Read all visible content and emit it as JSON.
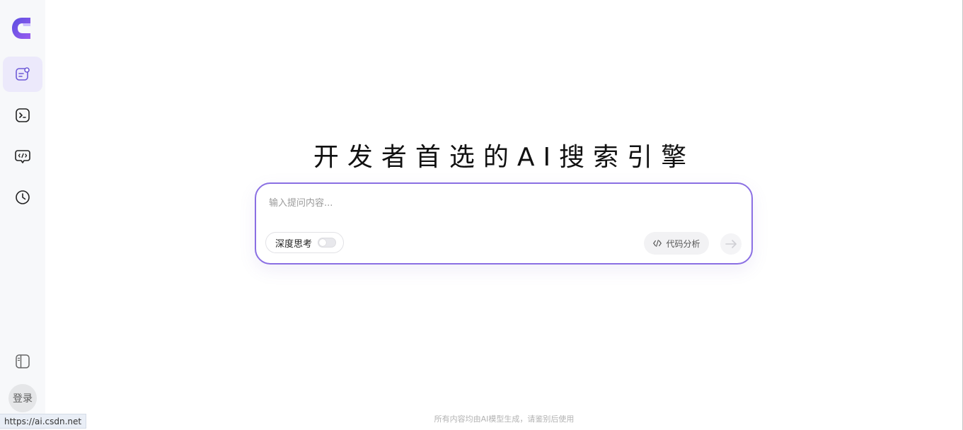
{
  "sidebar": {
    "logo_icon": "csdn-c-logo",
    "items": [
      {
        "icon": "chat-edit-icon",
        "active": true
      },
      {
        "icon": "terminal-icon",
        "active": false
      },
      {
        "icon": "code-chat-icon",
        "active": false
      },
      {
        "icon": "clock-history-icon",
        "active": false
      }
    ],
    "collapse_icon": "sidebar-toggle-icon",
    "login_label": "登录"
  },
  "status_bar": {
    "url": "https://ai.csdn.net"
  },
  "hero": {
    "title": "开发者首选的AI搜索引擎"
  },
  "composer": {
    "placeholder": "输入提问内容...",
    "deep_think_label": "深度思考",
    "deep_think_enabled": false,
    "code_analysis_label": "代码分析",
    "send_icon": "arrow-right-icon"
  },
  "footer": {
    "disclaimer": "所有内容均由AI模型生成，请鉴别后使用"
  },
  "colors": {
    "accent": "#8a6fe3",
    "active_bg": "#ece9fb",
    "sidebar_bg": "#f7f8fa"
  }
}
